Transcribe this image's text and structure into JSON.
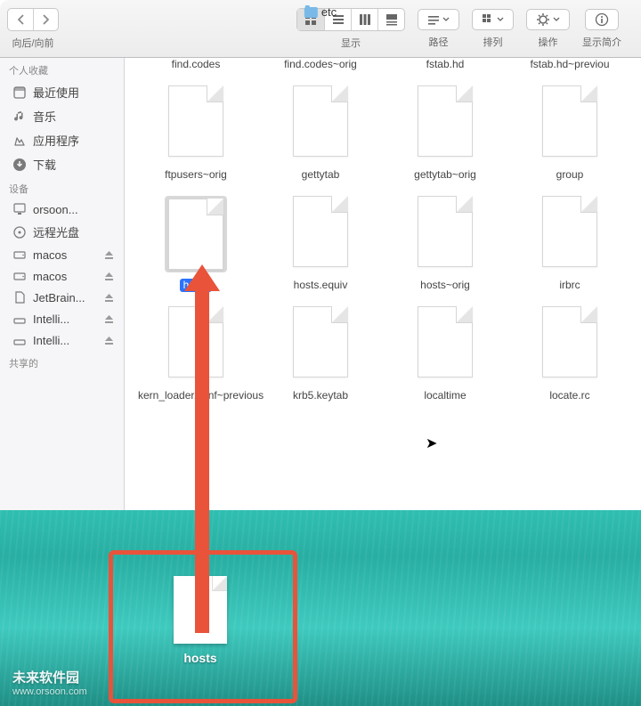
{
  "title": "etc",
  "toolbar": {
    "nav_label": "向后/向前",
    "view_label": "显示",
    "path_label": "路径",
    "arrange_label": "排列",
    "action_label": "操作",
    "info_label": "显示简介"
  },
  "sidebar": {
    "favorites_heading": "个人收藏",
    "favorites": [
      {
        "label": "最近使用"
      },
      {
        "label": "音乐"
      },
      {
        "label": "应用程序"
      },
      {
        "label": "下载"
      }
    ],
    "devices_heading": "设备",
    "devices": [
      {
        "label": "orsoon..."
      },
      {
        "label": "远程光盘"
      },
      {
        "label": "macos",
        "eject": true
      },
      {
        "label": "macos",
        "eject": true
      },
      {
        "label": "JetBrain...",
        "eject": true
      },
      {
        "label": "Intelli...",
        "eject": true
      },
      {
        "label": "Intelli...",
        "eject": true
      }
    ],
    "shared_heading": "共享的"
  },
  "files": {
    "row0": [
      "find.codes",
      "find.codes~orig",
      "fstab.hd",
      "fstab.hd~previou"
    ],
    "row1": [
      "ftpusers~orig",
      "gettytab",
      "gettytab~orig",
      "group"
    ],
    "row2": [
      "hosts",
      "hosts.equiv",
      "hosts~orig",
      "irbrc"
    ],
    "row3": [
      "kern_loader.conf~previous",
      "krb5.keytab",
      "localtime",
      "locate.rc"
    ]
  },
  "desktop_file": "hosts",
  "watermark": {
    "line1": "未来软件园",
    "line2": "www.orsoon.com"
  }
}
